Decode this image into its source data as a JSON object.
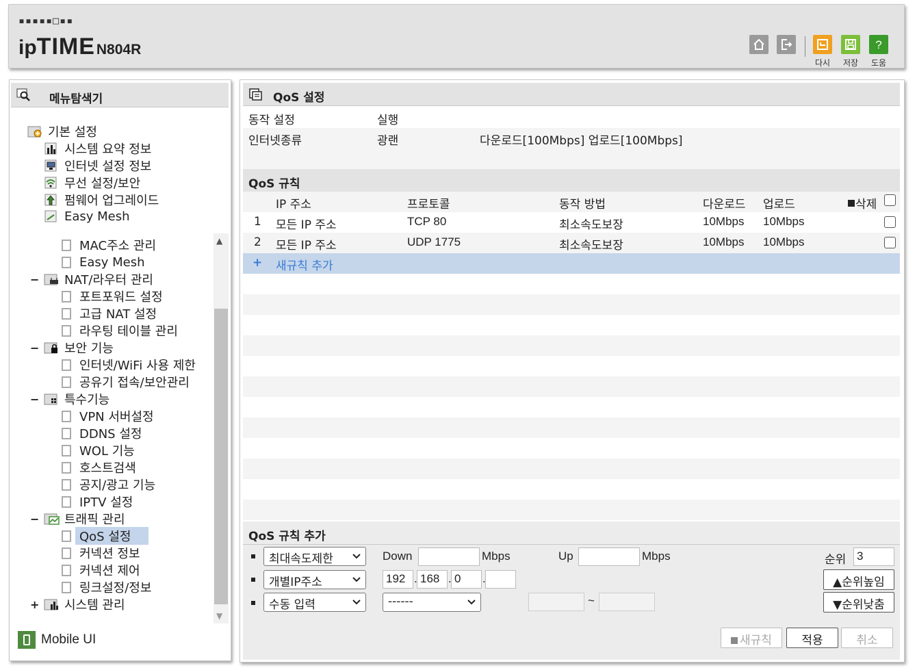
{
  "header": {
    "logo_dots": "▪▪▪▪▪□▪▪",
    "brand_ip": "ip",
    "brand_time": "TIME",
    "model": "N804R",
    "buttons": [
      {
        "name": "home",
        "label": ""
      },
      {
        "name": "logout",
        "label": ""
      },
      {
        "name": "reload",
        "label": "다시"
      },
      {
        "name": "save",
        "label": "저장"
      },
      {
        "name": "help",
        "label": "도움"
      }
    ]
  },
  "sidebar": {
    "title": "메뉴탐색기",
    "basic": {
      "label": "기본 설정",
      "items": [
        "시스템 요약 정보",
        "인터넷 설정 정보",
        "무선 설정/보안",
        "펌웨어 업그레이드",
        "Easy Mesh"
      ]
    },
    "advanced_partial": [
      "MAC주소 관리",
      "Easy Mesh"
    ],
    "groups": [
      {
        "expander": "−",
        "label": "NAT/라우터 관리",
        "items": [
          "포트포워드 설정",
          "고급 NAT 설정",
          "라우팅 테이블 관리"
        ]
      },
      {
        "expander": "−",
        "label": "보안 기능",
        "items": [
          "인터넷/WiFi 사용 제한",
          "공유기 접속/보안관리"
        ]
      },
      {
        "expander": "−",
        "label": "특수기능",
        "items": [
          "VPN 서버설정",
          "DDNS 설정",
          "WOL 기능",
          "호스트검색",
          "공지/광고 기능",
          "IPTV 설정"
        ]
      },
      {
        "expander": "−",
        "label": "트래픽 관리",
        "items": [
          "QoS 설정",
          "커넥션 정보",
          "커넥션 제어",
          "링크설정/정보"
        ]
      },
      {
        "expander": "+",
        "label": "시스템 관리",
        "items": []
      }
    ],
    "selected": "QoS 설정",
    "mobile_ui": "Mobile UI"
  },
  "main": {
    "title": "QoS 설정",
    "status": {
      "op_label": "동작 설정",
      "op_value": "실행",
      "inet_label": "인터넷종류",
      "inet_value": "광랜",
      "inet_speed": "다운로드[100Mbps] 업로드[100Mbps]"
    },
    "rules": {
      "title": "QoS 규칙",
      "columns": {
        "ip": "IP 주소",
        "protocol": "프로토콜",
        "method": "동작 방법",
        "down": "다운로드",
        "up": "업로드",
        "delete": "삭제"
      },
      "rows": [
        {
          "no": "1",
          "ip": "모든 IP 주소",
          "protocol": "TCP 80",
          "method": "최소속도보장",
          "down": "10Mbps",
          "up": "10Mbps"
        },
        {
          "no": "2",
          "ip": "모든 IP 주소",
          "protocol": "UDP 1775",
          "method": "최소속도보장",
          "down": "10Mbps",
          "up": "10Mbps"
        }
      ],
      "add_plus": "+",
      "add_label": "새규칙 추가"
    },
    "add_form": {
      "title": "QoS 규칙 추가",
      "mode_select": "최대속도제한",
      "down_label": "Down",
      "down_value": "",
      "down_unit": "Mbps",
      "up_label": "Up",
      "up_value": "",
      "up_unit": "Mbps",
      "priority_label": "순위",
      "priority_value": "3",
      "ip_select": "개별IP주소",
      "ip1": "192",
      "ip2": "168",
      "ip3": "0",
      "ip4": "",
      "ip_dot": ".",
      "port_select": "수동 입력",
      "proto_select": "------",
      "range_sep": "~",
      "port_from": "",
      "port_to": "",
      "raise_btn": "▲순위높임",
      "lower_btn": "▼순위낮춤",
      "new_rule_btn": "새규칙",
      "apply_btn": "적용",
      "cancel_btn": "취소"
    }
  },
  "colors": {
    "panel_bg": "#e3e3e3",
    "selected_bg": "#c4d4ea",
    "add_row_bg": "#c5d6ea",
    "link_blue": "#3a7bd5",
    "reload_orange": "#f0a020",
    "save_green": "#7cbf3a",
    "help_green": "#3a9a2a"
  }
}
